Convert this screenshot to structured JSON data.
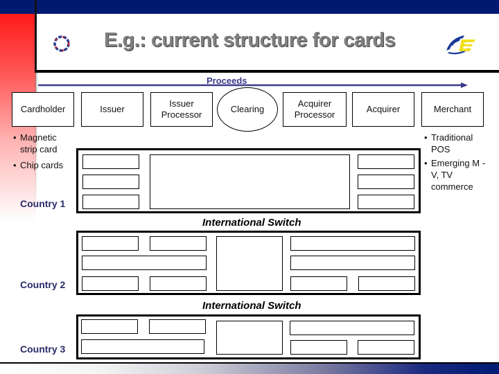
{
  "slide": {
    "title": "E.g.: current structure for cards",
    "logo_left": "ring-knot-logo-icon",
    "logo_right": "e-swoosh-logo-icon"
  },
  "flow": {
    "label": "Proceeds",
    "direction": "left-to-right",
    "entities": [
      {
        "label": "Cardholder",
        "shape": "rectangle"
      },
      {
        "label": "Issuer",
        "shape": "rectangle"
      },
      {
        "label": "Issuer Processor",
        "shape": "rectangle"
      },
      {
        "label": "Clearing",
        "shape": "oval"
      },
      {
        "label": "Acquirer Processor",
        "shape": "rectangle"
      },
      {
        "label": "Acquirer",
        "shape": "rectangle"
      },
      {
        "label": "Merchant",
        "shape": "rectangle"
      }
    ]
  },
  "cardholder_notes": [
    "Magnetic strip card",
    "Chip cards"
  ],
  "merchant_notes": [
    "Traditional POS",
    "Emerging M -V, TV commerce"
  ],
  "countries": [
    {
      "label": "Country 1"
    },
    {
      "label": "Country 2"
    },
    {
      "label": "Country 3"
    }
  ],
  "switches": [
    {
      "label": "International Switch"
    },
    {
      "label": "International Switch"
    }
  ],
  "colors": {
    "header_navy": "#001a72",
    "accent_red": "#ff1a1a",
    "title_gray": "#808080",
    "country_label": "#2a2a6a",
    "arrow": "#3a3a8a"
  }
}
